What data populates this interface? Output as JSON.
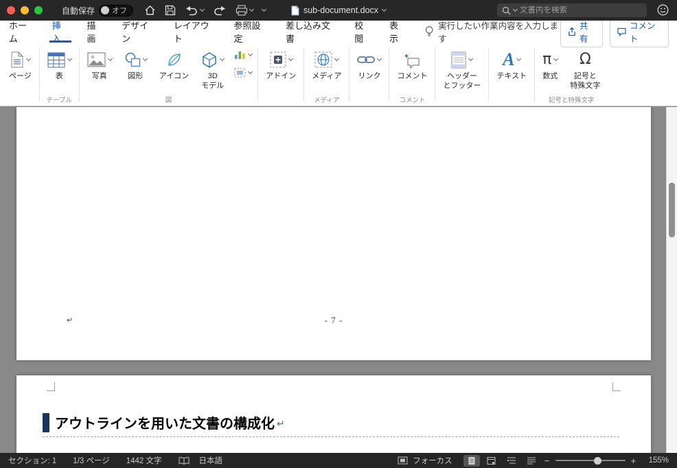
{
  "titlebar": {
    "autosave_label": "自動保存",
    "autosave_state": "オフ",
    "doc_title": "sub-document.docx",
    "search_placeholder": "文書内を検索"
  },
  "tabs": {
    "home": "ホーム",
    "insert": "挿入",
    "draw": "描画",
    "design": "デザイン",
    "layout": "レイアウト",
    "references": "参照設定",
    "mailings": "差し込み文書",
    "review": "校閲",
    "view": "表示"
  },
  "tellme": "実行したい作業内容を入力します",
  "actions": {
    "share": "共有",
    "comments": "コメント"
  },
  "ribbon": {
    "buttons": {
      "pages": "ページ",
      "table": "表",
      "pictures": "写真",
      "shapes": "図形",
      "icons": "アイコン",
      "model_l1": "3D",
      "model_l2": "モデル",
      "addins": "アドイン",
      "media": "メディア",
      "links": "リンク",
      "comment": "コメント",
      "hf_l1": "ヘッダー",
      "hf_l2": "とフッター",
      "text": "テキスト",
      "equation": "数式",
      "sym_l1": "記号と",
      "sym_l2": "特殊文字",
      "equation_glyph": "π",
      "symbol_glyph": "Ω"
    },
    "groups": {
      "table": "テーブル",
      "illustrations": "図",
      "media": "メディア",
      "comments": "コメント",
      "symbols": "記号と特殊文字"
    }
  },
  "document": {
    "page1": {
      "pilcrow": "↵",
      "footer": "- 7 -"
    },
    "page2": {
      "heading": "アウトラインを用いた文書の構成化",
      "return_mark": "↵"
    }
  },
  "statusbar": {
    "section": "セクション: 1",
    "page": "1/3 ページ",
    "chars": "1442 文字",
    "language": "日本語",
    "focus": "フォーカス",
    "zoom_out": "−",
    "zoom_in": "+",
    "zoom": "155%"
  },
  "colors": {
    "accent_blue": "#185abd",
    "heading_bar": "#17365d",
    "return_blue": "#2e75b6"
  }
}
